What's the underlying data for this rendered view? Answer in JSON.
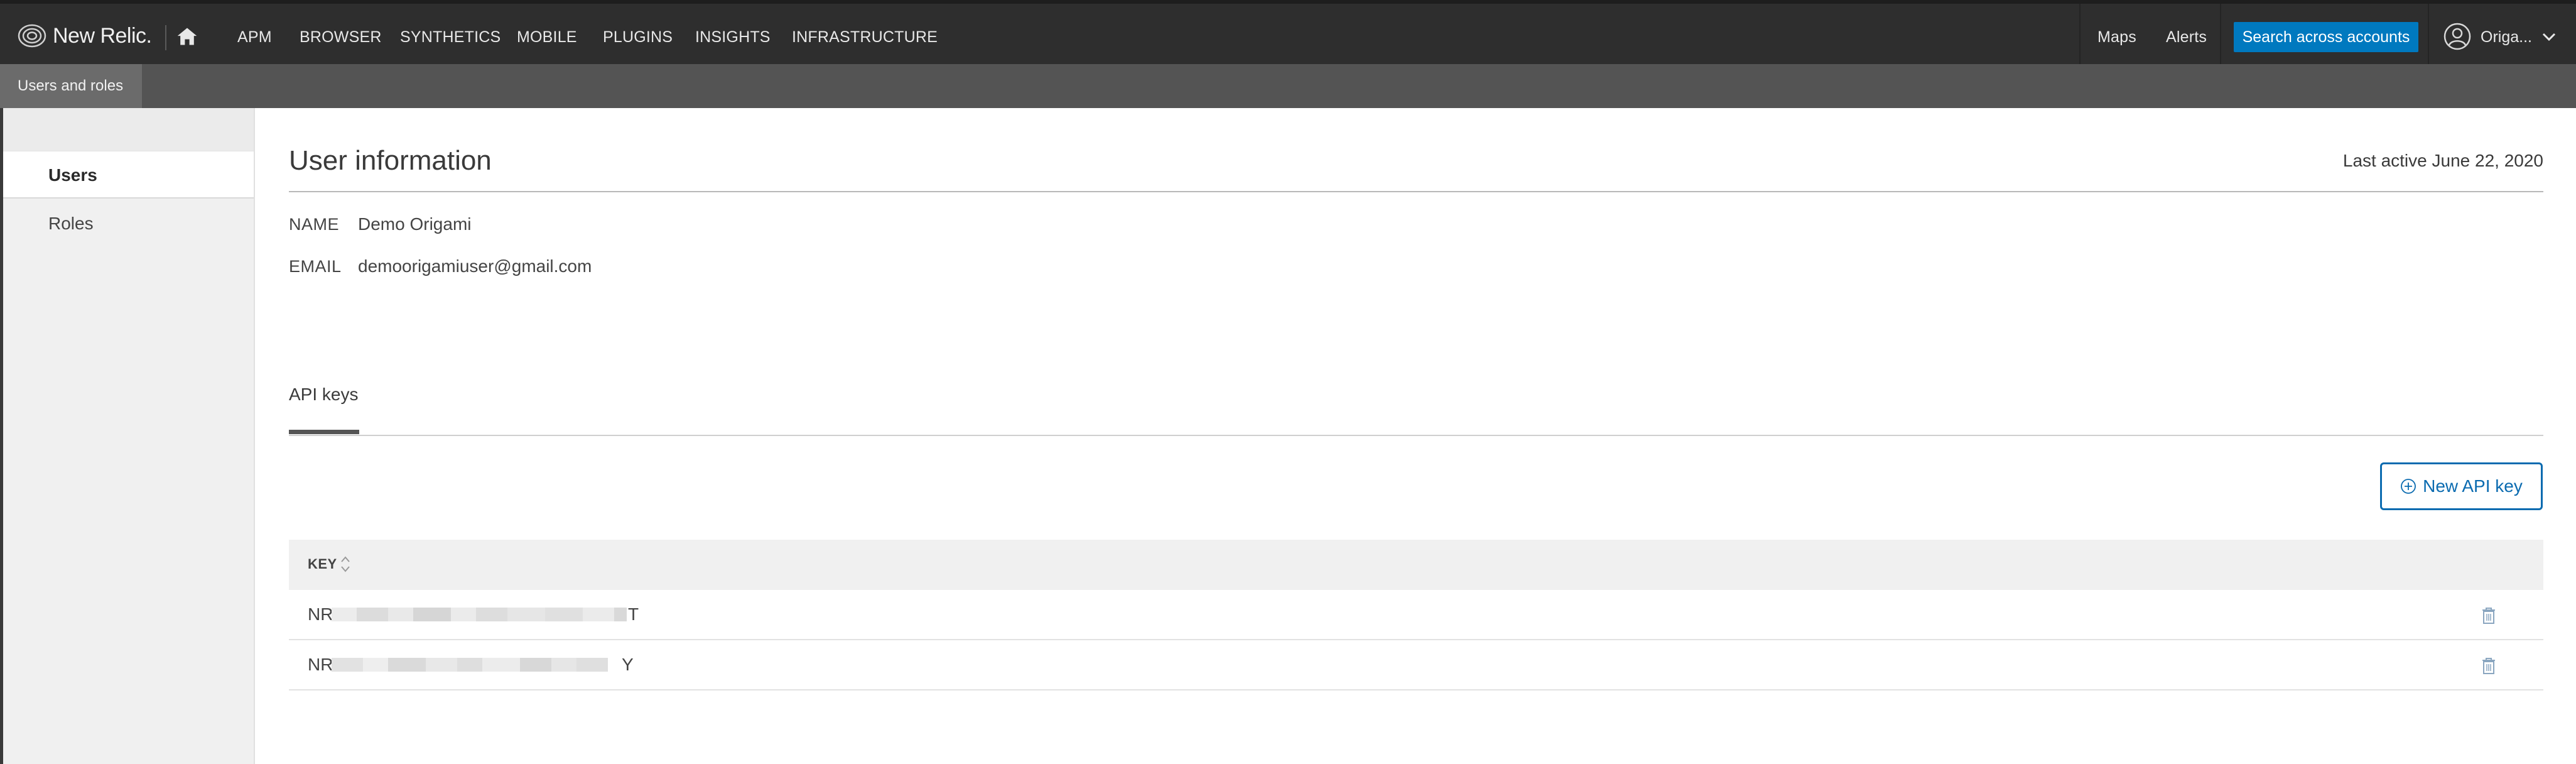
{
  "topnav": {
    "logo_text": "New Relic.",
    "items": [
      "APM",
      "BROWSER",
      "SYNTHETICS",
      "MOBILE",
      "PLUGINS",
      "INSIGHTS",
      "INFRASTRUCTURE"
    ],
    "maps_label": "Maps",
    "alerts_label": "Alerts",
    "search_label": "Search across accounts",
    "user_label": "Origa...",
    "accent": "#0079bf",
    "icons": [
      "new-relic-logo-icon",
      "home-icon",
      "user-avatar-icon",
      "chevron-down-icon"
    ]
  },
  "subnav": {
    "tab": "Users and roles"
  },
  "sidebar": {
    "items": [
      {
        "label": "Users",
        "active": true
      },
      {
        "label": "Roles",
        "active": false
      }
    ]
  },
  "main": {
    "title": "User information",
    "last_active": "Last active June 22, 2020",
    "fields": [
      {
        "label": "NAME",
        "value": "Demo Origami"
      },
      {
        "label": "EMAIL",
        "value": "demoorigamiuser@gmail.com"
      }
    ],
    "tab": "API keys",
    "new_key_label": "New API key",
    "table": {
      "header": "KEY",
      "rows": [
        {
          "prefix": "NR",
          "suffix": "T"
        },
        {
          "prefix": "NR",
          "suffix": "Y"
        }
      ]
    }
  }
}
